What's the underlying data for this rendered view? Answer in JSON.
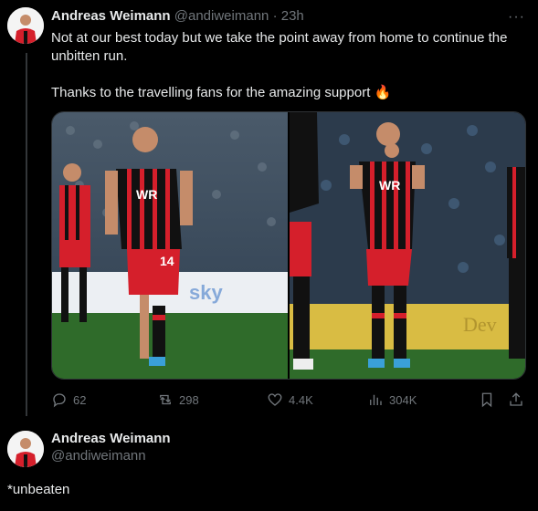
{
  "tweet": {
    "author_name": "Andreas Weimann",
    "author_handle": "@andiweimann",
    "separator": "·",
    "time": "23h",
    "more": "···",
    "text": "Not at our best today but we take the point away from home to continue the unbitten run.\n\nThanks to the travelling fans for the amazing support 🔥",
    "images": [
      {
        "alt": "player-running-photo",
        "shirt_sponsor": "WR",
        "shirt_number": "14"
      },
      {
        "alt": "player-clapping-photo",
        "shirt_sponsor": "WR"
      }
    ],
    "stats": {
      "replies": "62",
      "retweets": "298",
      "likes": "4.4K",
      "views": "304K"
    }
  },
  "reply": {
    "author_name": "Andreas Weimann",
    "author_handle": "@andiweimann",
    "text": "*unbeaten"
  },
  "colors": {
    "background": "#000000",
    "text": "#e7e9ea",
    "secondary": "#71767b",
    "shirt_red": "#d51f2b",
    "pitch": "#2f6b2a"
  }
}
